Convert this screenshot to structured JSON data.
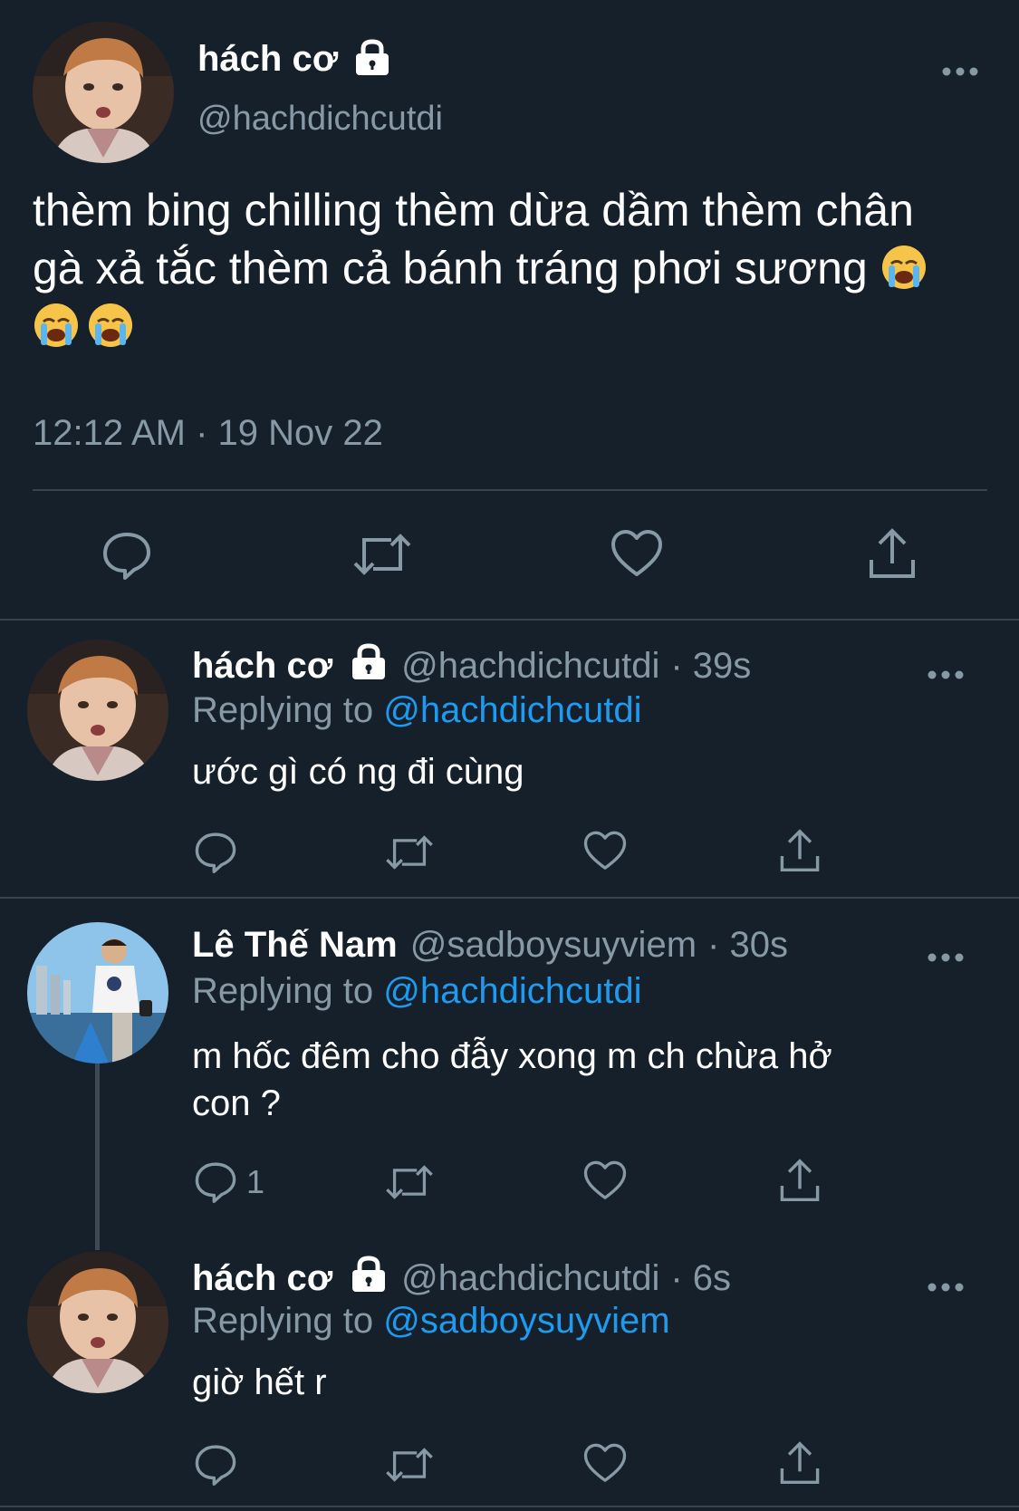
{
  "main_tweet": {
    "display_name": "hách cơ",
    "handle": "@hachdichcutdi",
    "text": "thèm bing chilling thèm dừa dầm thèm chân gà xả tắc thèm cả bánh tráng phơi sương",
    "emoji_count": 3,
    "timestamp": "12:12 AM · 19 Nov 22"
  },
  "replies": [
    {
      "display_name": "hách cơ",
      "handle": "@hachdichcutdi",
      "meta": "· 39s",
      "replying_label": "Replying to",
      "replying_to": "@hachdichcutdi",
      "text": "ước gì có ng đi cùng"
    },
    {
      "display_name": "Lê Thế Nam",
      "handle": "@sadboysuyviem",
      "meta": "· 30s",
      "replying_label": "Replying to",
      "replying_to": "@hachdichcutdi",
      "text_line1": "m hốc đêm cho đẫy xong m ch chừa hở",
      "text_line2": "con ?",
      "reply_count": "1"
    },
    {
      "display_name": "hách cơ",
      "handle": "@hachdichcutdi",
      "meta": "· 6s",
      "replying_label": "Replying to",
      "replying_to": "@sadboysuyviem",
      "text": "giờ hết r"
    }
  ],
  "icons": [
    "lock-icon",
    "more-icon",
    "reply-icon",
    "retweet-icon",
    "like-icon",
    "share-icon",
    "loudly-crying-face-emoji"
  ],
  "colors": {
    "background": "#15202b",
    "text": "#ffffff",
    "muted": "#8899a6",
    "link": "#1d9bf0",
    "divider": "#38444d"
  }
}
